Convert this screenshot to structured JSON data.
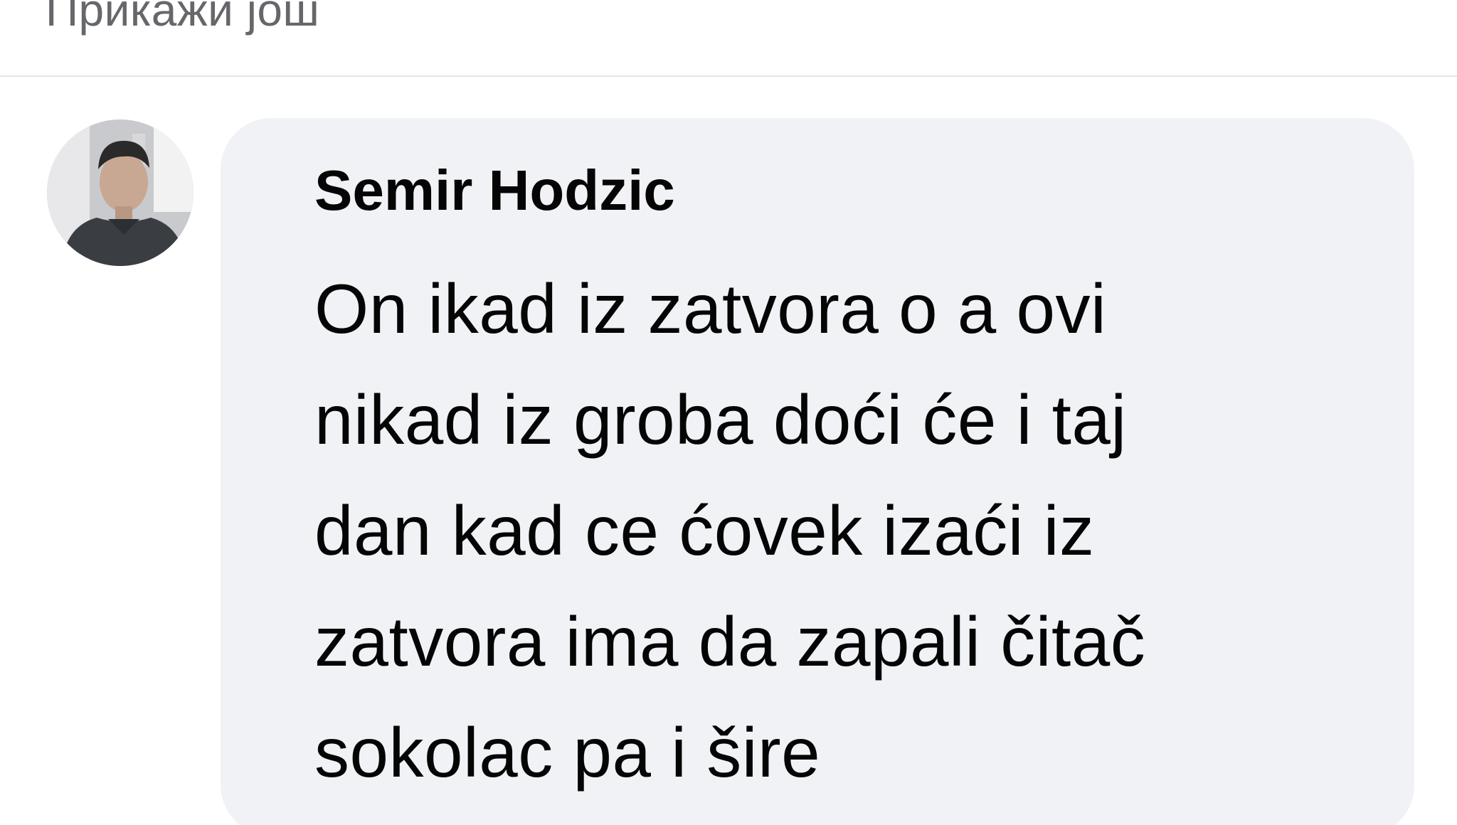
{
  "header": {
    "show_more_label": "Прикажи још"
  },
  "comment": {
    "author": "Semir Hodzic",
    "text_lines": [
      "On ikad iz zatvora o a ovi",
      "nikad iz groba doći će i taj",
      "dan kad ce ćovek izaći iz",
      "zatvora ima da zapali čitač",
      "sokolac pa i šire"
    ]
  },
  "colors": {
    "bubble_background": "#f0f2f5",
    "secondary_text": "#65676b",
    "primary_text": "#050505",
    "divider": "#e4e6eb"
  }
}
